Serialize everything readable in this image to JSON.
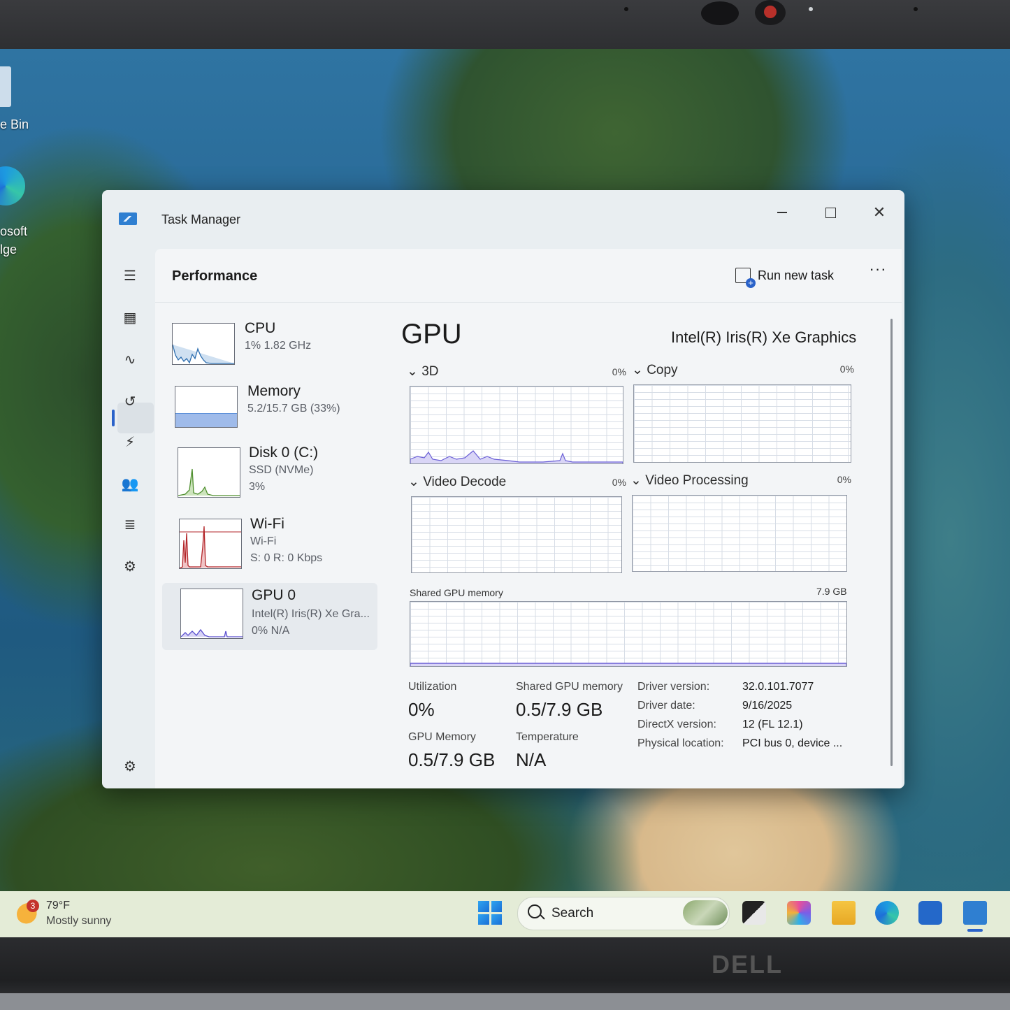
{
  "desktop": {
    "icons": [
      {
        "label": "e Bin",
        "icon": "recycle-bin-icon"
      },
      {
        "label": "osoft\nlge",
        "icon": "edge-icon"
      }
    ]
  },
  "window": {
    "title": "Task Manager",
    "minimize_icon": "minimize-icon",
    "maximize_icon": "maximize-icon",
    "close_label": "✕"
  },
  "nav": {
    "items": [
      {
        "id": "menu",
        "icon": "hamburger-icon",
        "glyph": "☰"
      },
      {
        "id": "processes",
        "icon": "processes-icon",
        "glyph": "▦"
      },
      {
        "id": "performance",
        "icon": "performance-icon",
        "glyph": "∿",
        "selected": true
      },
      {
        "id": "app-history",
        "icon": "history-icon",
        "glyph": "↺"
      },
      {
        "id": "startup-apps",
        "icon": "startup-icon",
        "glyph": "⚡"
      },
      {
        "id": "users",
        "icon": "users-icon",
        "glyph": "👥"
      },
      {
        "id": "details",
        "icon": "details-icon",
        "glyph": "≣"
      },
      {
        "id": "services",
        "icon": "services-icon",
        "glyph": "⚙"
      }
    ],
    "settings_glyph": "⚙"
  },
  "header": {
    "page_title": "Performance",
    "run_new_task": "Run new task",
    "more": "···"
  },
  "perf_list": [
    {
      "name": "CPU",
      "sub1": "1% 1.82 GHz",
      "color": "#2e6fb0"
    },
    {
      "name": "Memory",
      "sub1": "5.2/15.7 GB (33%)",
      "color": "#5b8fd8"
    },
    {
      "name": "Disk 0 (C:)",
      "sub1": "SSD (NVMe)",
      "sub2": "3%",
      "color": "#4f8f2f"
    },
    {
      "name": "Wi-Fi",
      "sub1": "Wi-Fi",
      "sub2": "S: 0 R: 0 Kbps",
      "color": "#b3262a"
    },
    {
      "name": "GPU 0",
      "sub1": "Intel(R) Iris(R) Xe Gra...",
      "sub2": "0% N/A",
      "color": "#5a4fcf",
      "selected": true
    }
  ],
  "gpu": {
    "title": "GPU",
    "model": "Intel(R) Iris(R) Xe Graphics",
    "engines": [
      {
        "label": "3D",
        "pct": "0%"
      },
      {
        "label": "Copy",
        "pct": "0%"
      },
      {
        "label": "Video Decode",
        "pct": "0%"
      },
      {
        "label": "Video Processing",
        "pct": "0%"
      }
    ],
    "shared_memory_label": "Shared GPU memory",
    "shared_memory_max": "7.9 GB",
    "stats": {
      "utilization_label": "Utilization",
      "utilization": "0%",
      "shared_mem_label": "Shared GPU memory",
      "shared_mem": "0.5/7.9 GB",
      "gpu_mem_label": "GPU Memory",
      "gpu_mem": "0.5/7.9 GB",
      "temp_label": "Temperature",
      "temp": "N/A"
    },
    "details": [
      {
        "key": "Driver version:",
        "value": "32.0.101.7077"
      },
      {
        "key": "Driver date:",
        "value": "9/16/2025"
      },
      {
        "key": "DirectX version:",
        "value": "12 (FL 12.1)"
      },
      {
        "key": "Physical location:",
        "value": "PCI bus 0, device ..."
      }
    ],
    "accent": "#6a5fd6"
  },
  "taskbar": {
    "weather_badge": "3",
    "weather_temp": "79°F",
    "weather_desc": "Mostly sunny",
    "search_placeholder": "Search",
    "apps": [
      "task-view-icon",
      "m365-icon",
      "file-explorer-icon",
      "edge-icon",
      "store-icon",
      "task-manager-icon"
    ]
  },
  "brand": "DELL"
}
